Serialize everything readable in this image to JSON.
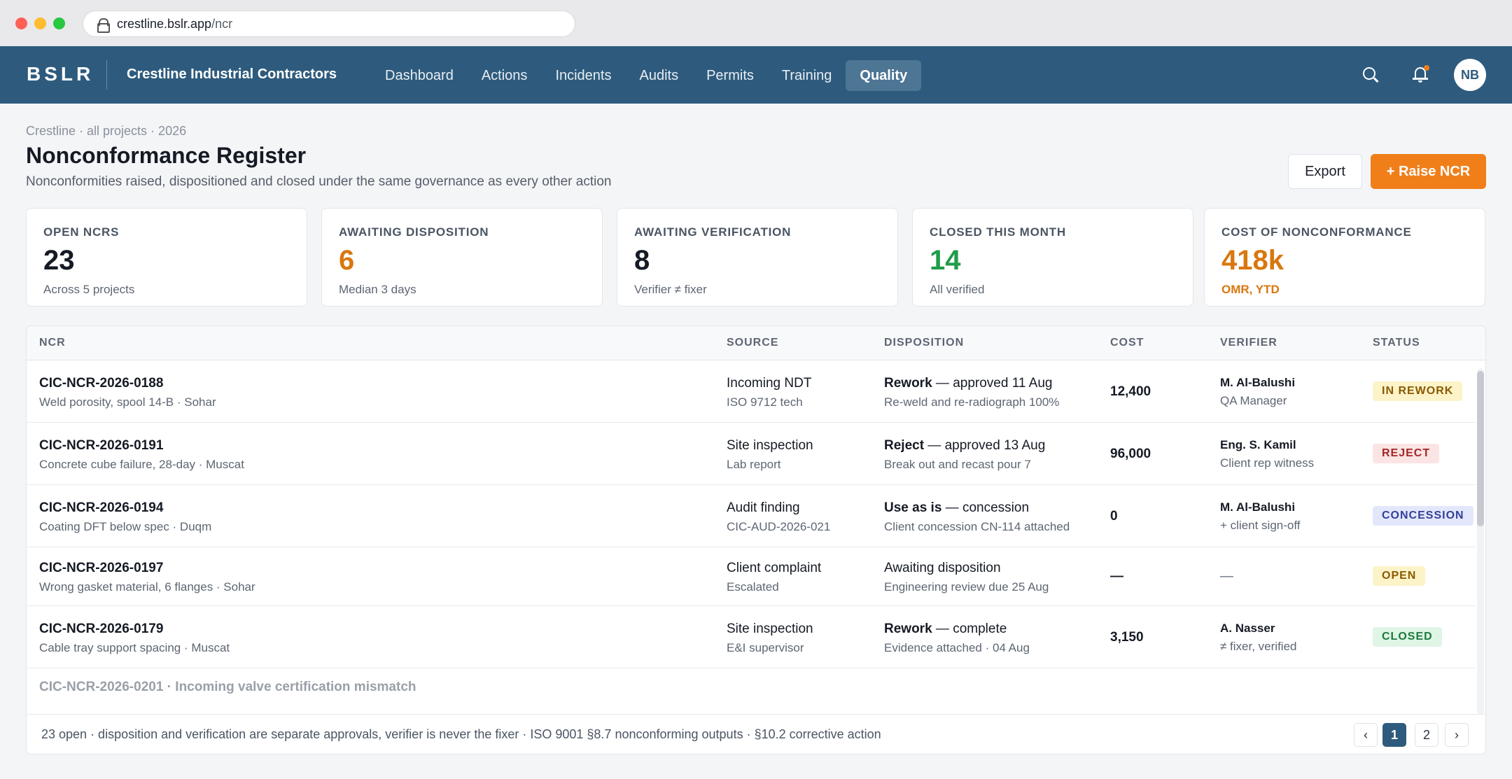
{
  "browser": {
    "url_host": "crestline.bslr.app",
    "url_path": "/ncr"
  },
  "nav": {
    "brand": "BSLR",
    "org": "Crestline Industrial Contractors",
    "items": [
      "Dashboard",
      "Actions",
      "Incidents",
      "Audits",
      "Permits",
      "Training",
      "Quality"
    ],
    "active": "Quality",
    "avatar": "NB",
    "accent": "#2e5b7d"
  },
  "header": {
    "breadcrumb": "Crestline · all projects · 2026",
    "title": "Nonconformance Register",
    "subtitle": "Nonconformities raised, dispositioned and closed under the same governance as every other action",
    "export_label": "Export",
    "raise_label": "+ Raise NCR",
    "raise_color": "#f07f1a"
  },
  "stats": [
    {
      "label": "OPEN NCRS",
      "value": "23",
      "note": "Across 5 projects",
      "color": "#151a24",
      "note_color": "#5d6673"
    },
    {
      "label": "AWAITING DISPOSITION",
      "value": "6",
      "note": "Median 3 days",
      "color": "#d9770f",
      "note_color": "#5d6673"
    },
    {
      "label": "AWAITING VERIFICATION",
      "value": "8",
      "note": "Verifier ≠ fixer",
      "color": "#151a24",
      "note_color": "#5d6673"
    },
    {
      "label": "CLOSED THIS MONTH",
      "value": "14",
      "note": "All verified",
      "color": "#1f9d4a",
      "note_color": "#5d6673"
    },
    {
      "label": "COST OF NONCONFORMANCE",
      "value": "418k",
      "note": "OMR, YTD",
      "color": "#d9770f",
      "note_color": "#d9770f"
    }
  ],
  "table": {
    "columns": [
      "NCR",
      "SOURCE",
      "DISPOSITION",
      "COST",
      "VERIFIER",
      "STATUS"
    ],
    "rows": [
      {
        "id": "CIC-NCR-2026-0188",
        "desc": "Weld porosity, spool 14-B · Sohar",
        "source": "Incoming NDT",
        "source_sub": "ISO 9712 tech",
        "disp_bold": "Rework",
        "disp_rest": " — approved 11 Aug",
        "disp_sub": "Re-weld and re-radiograph 100%",
        "cost": "12,400",
        "verifier": "M. Al-Balushi",
        "verifier_sub": "QA Manager",
        "verifier_bold": true,
        "status": "IN REWORK",
        "status_bg": "#fdf3c9",
        "status_fg": "#8a5a00"
      },
      {
        "id": "CIC-NCR-2026-0191",
        "desc": "Concrete cube failure, 28-day · Muscat",
        "source": "Site inspection",
        "source_sub": "Lab report",
        "disp_bold": "Reject",
        "disp_rest": " — approved 13 Aug",
        "disp_sub": "Break out and recast pour 7",
        "cost": "96,000",
        "verifier": "Eng. S. Kamil",
        "verifier_sub": "Client rep witness",
        "verifier_bold": true,
        "status": "REJECT",
        "status_bg": "#fbe4e4",
        "status_fg": "#a42626"
      },
      {
        "id": "CIC-NCR-2026-0194",
        "desc": "Coating DFT below spec · Duqm",
        "source": "Audit finding",
        "source_sub": "CIC-AUD-2026-021",
        "disp_bold": "Use as is",
        "disp_rest": " — concession",
        "disp_sub": "Client concession CN-114 attached",
        "cost": "0",
        "verifier": "M. Al-Balushi",
        "verifier_sub": "+ client sign-off",
        "verifier_bold": true,
        "status": "CONCESSION",
        "status_bg": "#e3e7fb",
        "status_fg": "#34409a"
      },
      {
        "id": "CIC-NCR-2026-0197",
        "desc": "Wrong gasket material, 6 flanges · Sohar",
        "source": "Client complaint",
        "source_sub": "Escalated",
        "disp_bold": "",
        "disp_rest": "Awaiting disposition",
        "disp_sub": "Engineering review due 25 Aug",
        "cost": "—",
        "verifier": "—",
        "verifier_sub": "",
        "verifier_bold": false,
        "status": "OPEN",
        "status_bg": "#fdf3c9",
        "status_fg": "#8a5a00"
      },
      {
        "id": "CIC-NCR-2026-0179",
        "desc": "Cable tray support spacing · Muscat",
        "source": "Site inspection",
        "source_sub": "E&I supervisor",
        "disp_bold": "Rework",
        "disp_rest": " — complete",
        "disp_sub": "Evidence attached · 04 Aug",
        "cost": "3,150",
        "verifier": "A. Nasser",
        "verifier_sub": "≠ fixer, verified",
        "verifier_bold": true,
        "status": "CLOSED",
        "status_bg": "#dff5e6",
        "status_fg": "#1c7a3c"
      }
    ],
    "partial_row": "CIC-NCR-2026-0201 · Incoming valve certification mismatch",
    "footer": "23 open · disposition and verification are separate approvals, verifier is never the fixer · ISO 9001 §8.7 nonconforming outputs · §10.2 corrective action",
    "pager": {
      "prev": "‹",
      "pages": [
        "1",
        "2"
      ],
      "current": "1",
      "next": "›"
    }
  }
}
